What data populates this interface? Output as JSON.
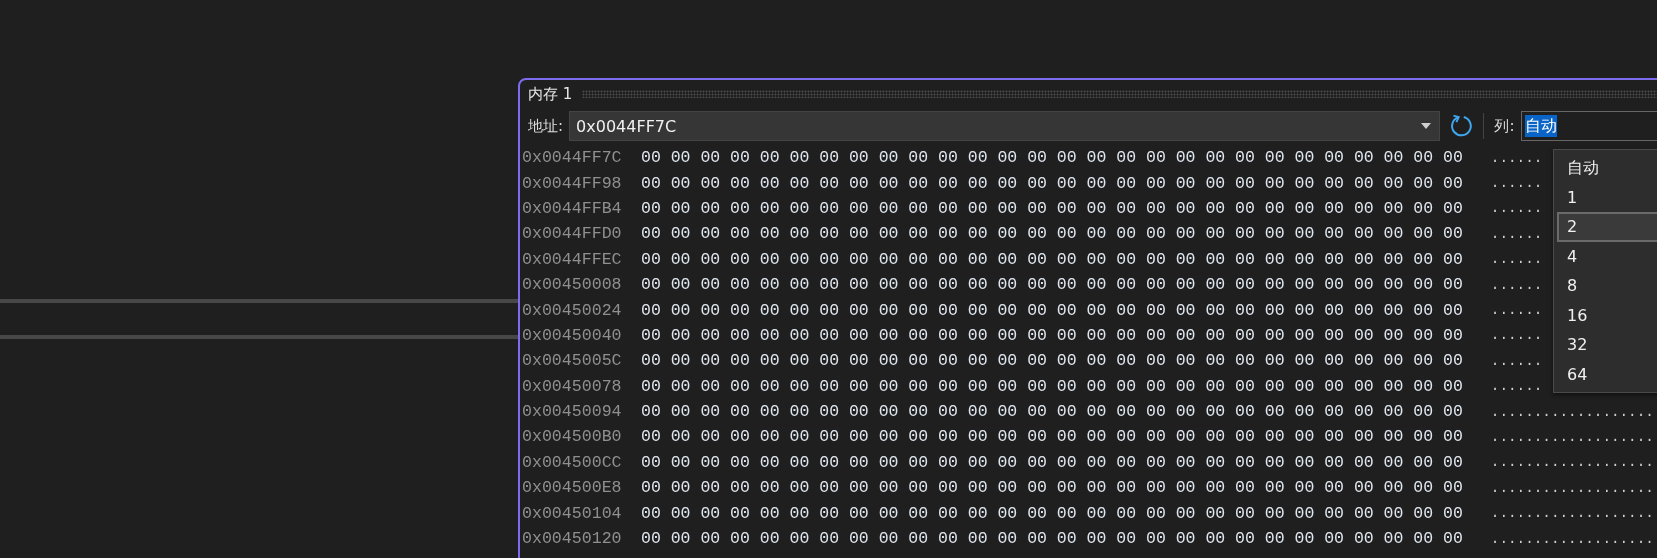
{
  "window": {
    "title": "内存 1"
  },
  "toolbar": {
    "address_label": "地址:",
    "address": "0x0044FF7C",
    "columns_label": "列:",
    "columns_value": "自动"
  },
  "columns_dropdown": {
    "options": [
      {
        "label": "自动",
        "selected": false
      },
      {
        "label": "1",
        "selected": false
      },
      {
        "label": "2",
        "selected": true
      },
      {
        "label": "4",
        "selected": false
      },
      {
        "label": "8",
        "selected": false
      },
      {
        "label": "16",
        "selected": false
      },
      {
        "label": "32",
        "selected": false
      },
      {
        "label": "64",
        "selected": false
      }
    ]
  },
  "rows": [
    {
      "address": "0x0044FF7C",
      "hex": "00 00 00 00 00 00 00 00 00 00 00 00 00 00 00 00 00 00 00 00 00 00 00 00 00 00 00 00",
      "ascii": "......"
    },
    {
      "address": "0x0044FF98",
      "hex": "00 00 00 00 00 00 00 00 00 00 00 00 00 00 00 00 00 00 00 00 00 00 00 00 00 00 00 00",
      "ascii": "......"
    },
    {
      "address": "0x0044FFB4",
      "hex": "00 00 00 00 00 00 00 00 00 00 00 00 00 00 00 00 00 00 00 00 00 00 00 00 00 00 00 00",
      "ascii": "......"
    },
    {
      "address": "0x0044FFD0",
      "hex": "00 00 00 00 00 00 00 00 00 00 00 00 00 00 00 00 00 00 00 00 00 00 00 00 00 00 00 00",
      "ascii": "......"
    },
    {
      "address": "0x0044FFEC",
      "hex": "00 00 00 00 00 00 00 00 00 00 00 00 00 00 00 00 00 00 00 00 00 00 00 00 00 00 00 00",
      "ascii": "......"
    },
    {
      "address": "0x00450008",
      "hex": "00 00 00 00 00 00 00 00 00 00 00 00 00 00 00 00 00 00 00 00 00 00 00 00 00 00 00 00",
      "ascii": "......"
    },
    {
      "address": "0x00450024",
      "hex": "00 00 00 00 00 00 00 00 00 00 00 00 00 00 00 00 00 00 00 00 00 00 00 00 00 00 00 00",
      "ascii": "......"
    },
    {
      "address": "0x00450040",
      "hex": "00 00 00 00 00 00 00 00 00 00 00 00 00 00 00 00 00 00 00 00 00 00 00 00 00 00 00 00",
      "ascii": "......"
    },
    {
      "address": "0x0045005C",
      "hex": "00 00 00 00 00 00 00 00 00 00 00 00 00 00 00 00 00 00 00 00 00 00 00 00 00 00 00 00",
      "ascii": "......"
    },
    {
      "address": "0x00450078",
      "hex": "00 00 00 00 00 00 00 00 00 00 00 00 00 00 00 00 00 00 00 00 00 00 00 00 00 00 00 00",
      "ascii": "......"
    },
    {
      "address": "0x00450094",
      "hex": "00 00 00 00 00 00 00 00 00 00 00 00 00 00 00 00 00 00 00 00 00 00 00 00 00 00 00 00",
      "ascii": "..................."
    },
    {
      "address": "0x004500B0",
      "hex": "00 00 00 00 00 00 00 00 00 00 00 00 00 00 00 00 00 00 00 00 00 00 00 00 00 00 00 00",
      "ascii": "..................."
    },
    {
      "address": "0x004500CC",
      "hex": "00 00 00 00 00 00 00 00 00 00 00 00 00 00 00 00 00 00 00 00 00 00 00 00 00 00 00 00",
      "ascii": "..................."
    },
    {
      "address": "0x004500E8",
      "hex": "00 00 00 00 00 00 00 00 00 00 00 00 00 00 00 00 00 00 00 00 00 00 00 00 00 00 00 00",
      "ascii": "..................."
    },
    {
      "address": "0x00450104",
      "hex": "00 00 00 00 00 00 00 00 00 00 00 00 00 00 00 00 00 00 00 00 00 00 00 00 00 00 00 00",
      "ascii": "..................."
    },
    {
      "address": "0x00450120",
      "hex": "00 00 00 00 00 00 00 00 00 00 00 00 00 00 00 00 00 00 00 00 00 00 00 00 00 00 00 00",
      "ascii": "..................."
    }
  ]
}
